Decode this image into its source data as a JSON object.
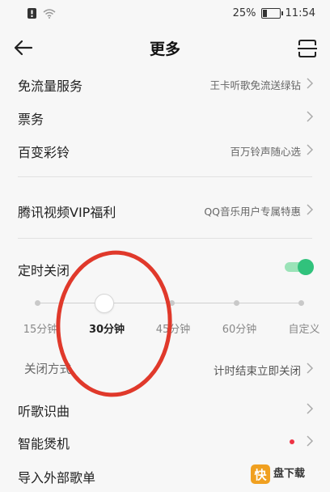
{
  "status": {
    "battery": "25%",
    "time": "11:54",
    "battery_level": 0.25
  },
  "header": {
    "title": "更多"
  },
  "items": [
    {
      "label": "免流量服务",
      "value": "王卡听歌免流送绿钻"
    },
    {
      "label": "票务",
      "value": ""
    },
    {
      "label": "百变彩铃",
      "value": "百万铃声随心选"
    },
    {
      "label": "腾讯视频VIP福利",
      "value": "QQ音乐用户专属特惠"
    }
  ],
  "timer": {
    "label": "定时关闭",
    "enabled": true,
    "options": [
      "15分钟",
      "30分钟",
      "45分钟",
      "60分钟",
      "自定义"
    ],
    "selected": "30分钟",
    "close_mode_label": "关闭方式",
    "close_mode_value": "计时结束立即关闭"
  },
  "more_items": [
    {
      "label": "听歌识曲"
    },
    {
      "label": "智能煲机"
    },
    {
      "label": "导入外部歌单"
    }
  ],
  "watermark": {
    "text": "快盘下载"
  },
  "colors": {
    "accent_green": "#31c27c",
    "annotation_red": "#e0392b",
    "badge_red": "#ee3344"
  },
  "icons": [
    "alert-icon",
    "wifi-icon",
    "battery-icon",
    "back-arrow-icon",
    "scan-icon",
    "chevron-right-icon"
  ]
}
